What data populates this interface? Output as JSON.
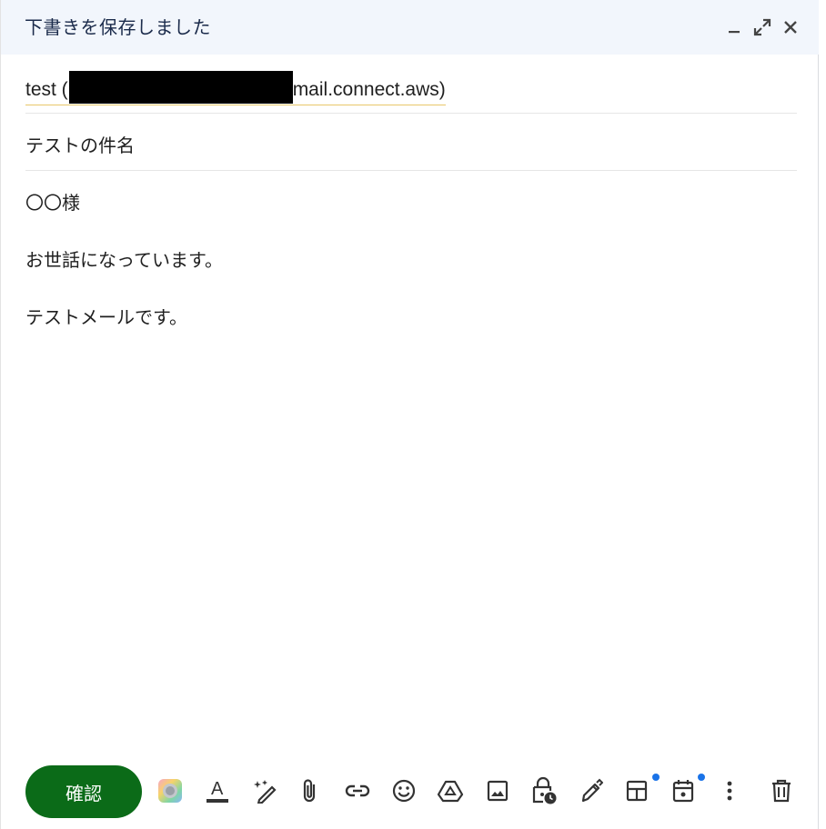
{
  "window": {
    "title": "下書きを保存しました"
  },
  "header_icons": [
    "minimize-icon",
    "expand-icon",
    "close-icon"
  ],
  "recipient": {
    "name": "test (",
    "address_suffix": "mail.connect.aws)"
  },
  "subject": "テストの件名",
  "body": {
    "line1": "〇〇様",
    "line2": "お世話になっています。",
    "line3": "テストメールです。"
  },
  "toolbar": {
    "send_label": "確認",
    "icons": [
      "ai-assist-icon",
      "text-format-icon",
      "help-me-write-icon",
      "attach-icon",
      "link-icon",
      "emoji-icon",
      "drive-icon",
      "photo-icon",
      "confidential-lock-icon",
      "signature-pen-icon",
      "layout-icon",
      "schedule-event-icon",
      "more-options-icon",
      "trash-icon"
    ]
  },
  "colors": {
    "header_bg": "#f2f6fc",
    "send_button": "#0b6b18",
    "notification_dot": "#1a73e8"
  }
}
